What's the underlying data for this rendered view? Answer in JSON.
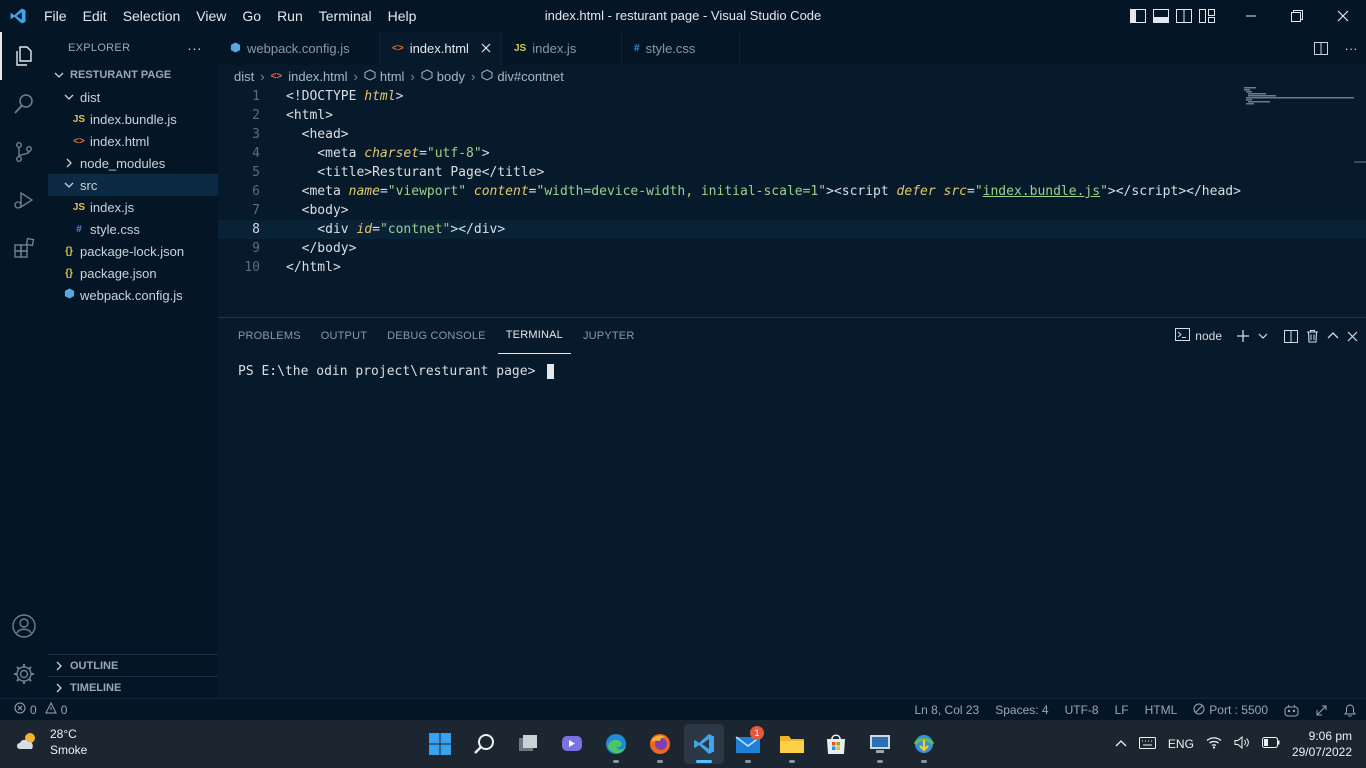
{
  "window": {
    "title": "index.html - resturant page - Visual Studio Code"
  },
  "menu": [
    "File",
    "Edit",
    "Selection",
    "View",
    "Go",
    "Run",
    "Terminal",
    "Help"
  ],
  "sidebar": {
    "header": "EXPLORER",
    "project": "RESTURANT PAGE",
    "tree": [
      {
        "label": "dist",
        "type": "folder"
      },
      {
        "label": "index.bundle.js",
        "type": "js",
        "icon": "JS"
      },
      {
        "label": "index.html",
        "type": "html",
        "icon": "<>"
      },
      {
        "label": "node_modules",
        "type": "folder"
      },
      {
        "label": "src",
        "type": "folder"
      },
      {
        "label": "index.js",
        "type": "js",
        "icon": "JS"
      },
      {
        "label": "style.css",
        "type": "css",
        "icon": "#"
      },
      {
        "label": "package-lock.json",
        "type": "json",
        "icon": "{}"
      },
      {
        "label": "package.json",
        "type": "json",
        "icon": "{}"
      },
      {
        "label": "webpack.config.js",
        "type": "webpack"
      }
    ],
    "outline": "OUTLINE",
    "timeline": "TIMELINE"
  },
  "tabs": [
    {
      "label": "webpack.config.js",
      "icon": ""
    },
    {
      "label": "index.html",
      "icon": "<>"
    },
    {
      "label": "index.js",
      "icon": "JS"
    },
    {
      "label": "style.css",
      "icon": "#"
    }
  ],
  "breadcrumb": [
    "dist",
    "index.html",
    "html",
    "body",
    "div#contnet"
  ],
  "editor": {
    "line_numbers": [
      "1",
      "2",
      "3",
      "4",
      "5",
      "6",
      "7",
      "8",
      "9",
      "10"
    ]
  },
  "panel": {
    "tabs": [
      "PROBLEMS",
      "OUTPUT",
      "DEBUG CONSOLE",
      "TERMINAL",
      "JUPYTER"
    ],
    "terminal_name": "node",
    "prompt": "PS E:\\the odin project\\resturant page> "
  },
  "status": {
    "errors": "0",
    "warnings": "0",
    "position": "Ln 8, Col 23",
    "spaces": "Spaces: 4",
    "encoding": "UTF-8",
    "eol": "LF",
    "language": "HTML",
    "port": "Port : 5500"
  },
  "taskbar": {
    "temperature": "28°C",
    "weather": "Smoke",
    "mail_badge": "1",
    "language": "ENG",
    "time": "9:06 pm",
    "date": "29/07/2022"
  },
  "colors": {
    "accent": "#4cc2ff",
    "editor_bg": "#071a2b",
    "chrome_bg": "#041626"
  }
}
